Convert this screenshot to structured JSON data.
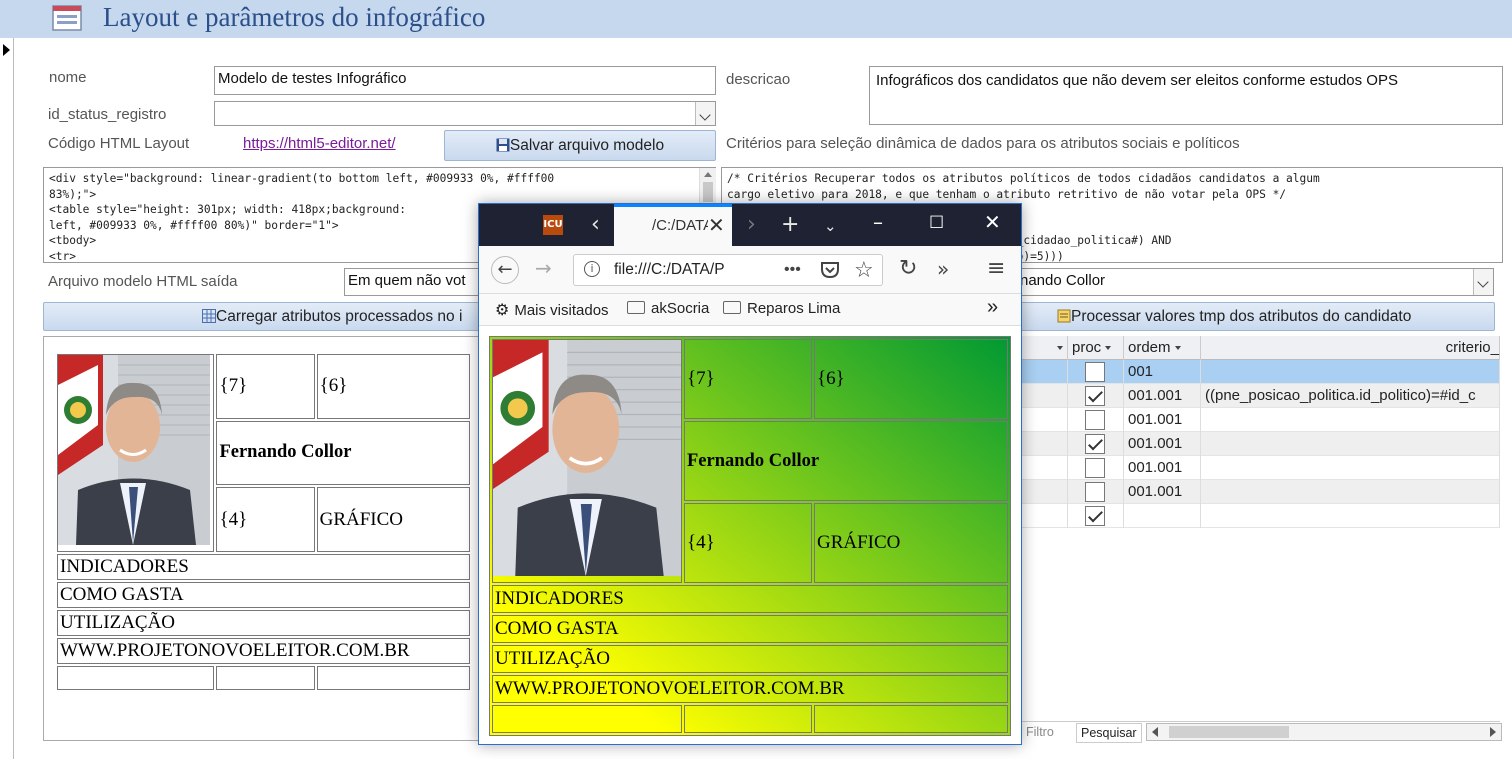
{
  "form": {
    "title": "Layout e parâmetros do infográfico",
    "nome_label": "nome",
    "nome_value": "Modelo de testes Infográfico",
    "descricao_label": "descricao",
    "descricao_value": "Infográficos dos candidatos que não devem ser eleitos conforme estudos OPS",
    "status_label": "id_status_registro",
    "status_value": "",
    "codigo_label": "Código HTML Layout",
    "editor_link": "https://html5-editor.net/",
    "salvar_button": "Salvar arquivo modelo",
    "criterios_label": "Critérios para seleção dinâmica de dados para os atributos sociais e políticos",
    "html_code": "<div style=\"background: linear-gradient(to bottom left, #009933 0%, #ffff00\n83%);\">\n<table style=\"height: 301px; width: 418px;background: \nleft, #009933 0%, #ffff00 80%)\" border=\"1\">\n<tbody>\n<tr>",
    "criterios_code": "/* Critérios Recuperar todos os atributos políticos de todos cidadãos candidatos a algum\ncargo eletivo para 2018, e que tenham o atributo retritivo de não votar pela OPS */\n\n\n                                        #id_cidadao_politica#) AND\n                                        icao)=5)))",
    "arquivo_label": "Arquivo modelo HTML saída",
    "arquivo_value": "Em quem não vot",
    "candidato_value": "nando Collor",
    "carregar_button": "Carregar atributos processados no i",
    "processar_button": "Processar valores tmp dos atributos do candidato"
  },
  "infographic": {
    "cell7": "{7}",
    "cell6": "{6}",
    "name": "Fernando Collor",
    "cell4": "{4}",
    "grafico": "GRÁFICO",
    "indicadores": "INDICADORES",
    "como_gasta": "COMO GASTA",
    "utilizacao": "UTILIZAÇÃO",
    "site": "WWW.PROJETONOVOELEITOR.COM.BR"
  },
  "grid": {
    "col_proc": "proc",
    "col_ordem": "ordem",
    "col_criterio": "criterio_",
    "rows": [
      {
        "proc": false,
        "ordem": "001",
        "criterio": ""
      },
      {
        "proc": true,
        "ordem": "001.001",
        "criterio": "((pne_posicao_politica.id_politico)=#id_c"
      },
      {
        "proc": false,
        "ordem": "001.001",
        "criterio": ""
      },
      {
        "proc": true,
        "ordem": "001.001",
        "criterio": ""
      },
      {
        "proc": false,
        "ordem": "001.001",
        "criterio": ""
      },
      {
        "proc": false,
        "ordem": "001.001",
        "criterio": ""
      },
      {
        "proc": true,
        "ordem": "",
        "criterio": ""
      }
    ],
    "filtro": "Filtro",
    "pesquisar": "Pesquisar"
  },
  "browser": {
    "tab_icon_text": "ICU",
    "tab_title": "/C:/DATA/",
    "url": "file:///C:/DATA/P",
    "bookmarks": [
      "Mais visitados",
      "akSocria",
      "Reparos Lima"
    ]
  }
}
